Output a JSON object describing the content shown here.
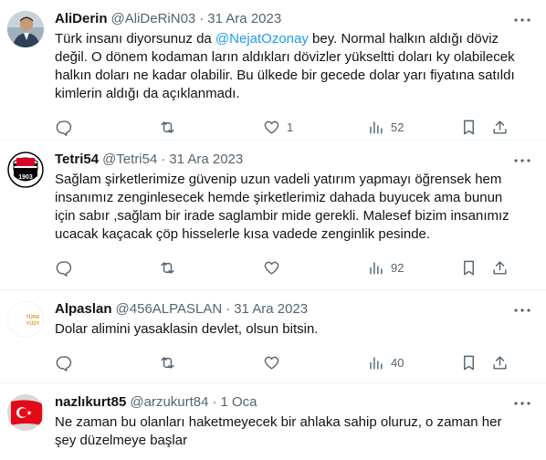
{
  "tweets": [
    {
      "name": "AliDerin",
      "handle": "@AliDeRiN03",
      "date": "31 Ara 2023",
      "text_before": "Türk insanı diyorsunuz da ",
      "mention": "@NejatOzonay",
      "text_after": " bey. Normal halkın aldığı döviz değil. O dönem kodaman ların aldıkları dövizler yükseltti doları ky olabilecek halkın doları ne kadar olabilir. Bu ülkede bir gecede dolar yarı fiyatına satıldı kimlerin aldığı da açıklanmadı.",
      "reply_count": "",
      "retweet_count": "",
      "like_count": "1",
      "view_count": "52",
      "avatar_icon": "man-portrait-avatar"
    },
    {
      "name": "Tetri54",
      "handle": "@Tetri54",
      "date": "31 Ara 2023",
      "text_before": "Sağlam şirketlerimize güvenip uzun vadeli yatırım yapmayı öğrensek hem insanımız zenginlesecek hemde şirketlerimiz dahada buyucek ama bunun için sabır ,sağlam bir irade saglambir mide gerekli. Malesef bizim insanımız ucacak kaçacak çöp hisselerle kısa vadede zenginlik pesinde.",
      "mention": "",
      "text_after": "",
      "reply_count": "",
      "retweet_count": "",
      "like_count": "",
      "view_count": "92",
      "avatar_icon": "besiktas-1903-crest-avatar"
    },
    {
      "name": "Alpaslan",
      "handle": "@456ALPASLAN",
      "date": "31 Ara 2023",
      "text_before": "Dolar alimini yasaklasin devlet, olsun bitsin.",
      "mention": "",
      "text_after": "",
      "reply_count": "",
      "retweet_count": "",
      "like_count": "",
      "view_count": "40",
      "avatar_icon": "turk-yuzyili-logo-avatar",
      "avatar_text_1": "TÜRK",
      "avatar_text_2": "YÜZY"
    },
    {
      "name": "nazlıkurt85",
      "handle": "@arzukurt84",
      "date": "1 Oca",
      "text_before": "Ne zaman bu olanları haketmeyecek bir ahlaka sahip oluruz, o zaman her şey düzelmeye başlar",
      "mention": "",
      "text_after": "",
      "avatar_icon": "turkish-flag-avatar"
    }
  ],
  "dot": "·",
  "colors": {
    "accent": "#1d9bf0",
    "secondary": "#536471",
    "text": "#0f1419",
    "divider": "#eff3f4"
  },
  "icons": [
    "more-icon",
    "reply-icon",
    "retweet-icon",
    "like-icon",
    "views-icon",
    "bookmark-icon",
    "share-icon"
  ]
}
